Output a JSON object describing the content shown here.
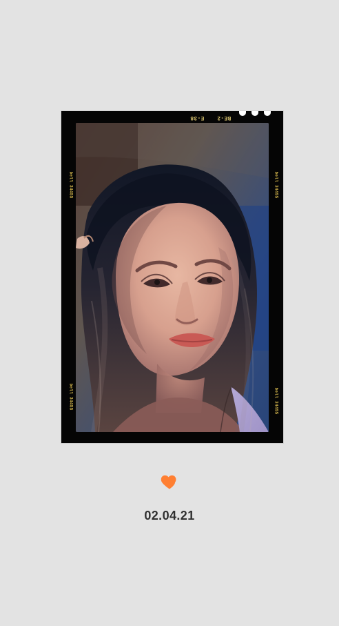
{
  "film": {
    "top_code_left": "E-38",
    "top_code_right": "BE-2",
    "side_code": "bell 3445S"
  },
  "decorations": {
    "heart_icon": "heart-icon",
    "heart_color": "#ff7f32"
  },
  "caption": {
    "date": "02.04.21"
  }
}
